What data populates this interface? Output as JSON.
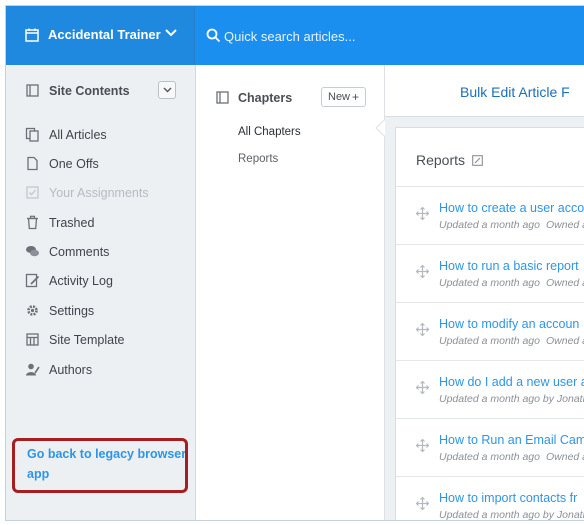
{
  "header": {
    "site_name": "Accidental Trainer",
    "search_placeholder": "Quick search articles..."
  },
  "sidebar": {
    "title": "Site Contents",
    "items": [
      {
        "label": "All Articles",
        "icon": "copy-icon",
        "disabled": false
      },
      {
        "label": "One Offs",
        "icon": "document-icon",
        "disabled": false
      },
      {
        "label": "Your Assignments",
        "icon": "checkbox-icon",
        "disabled": true
      },
      {
        "label": "Trashed",
        "icon": "trash-icon",
        "disabled": false
      },
      {
        "label": "Comments",
        "icon": "comments-icon",
        "disabled": false
      },
      {
        "label": "Activity Log",
        "icon": "activity-icon",
        "disabled": false
      },
      {
        "label": "Settings",
        "icon": "gear-icon",
        "disabled": false
      },
      {
        "label": "Site Template",
        "icon": "template-icon",
        "disabled": false
      },
      {
        "label": "Authors",
        "icon": "author-icon",
        "disabled": false
      }
    ],
    "legacy_link": "Go back to legacy browser app"
  },
  "chapters": {
    "title": "Chapters",
    "new_label": "New",
    "new_icon": "+",
    "items": [
      "All Chapters",
      "Reports"
    ]
  },
  "main": {
    "title": "Bulk Edit Article F",
    "section_title": "Reports",
    "articles": [
      {
        "title": "How to create a user acco",
        "updated": "Updated a month ago",
        "owner": "Owned a"
      },
      {
        "title": "How to run a basic report",
        "updated": "Updated a month ago",
        "owner": "Owned a"
      },
      {
        "title": "How to modify an accoun",
        "updated": "Updated a month ago",
        "owner": "Owned a"
      },
      {
        "title": "How do I add a new user a",
        "updated": "Updated a month ago by Jonath",
        "owner": ""
      },
      {
        "title": "How to Run an Email Cam",
        "updated": "Updated a month ago",
        "owner": "Owned a"
      },
      {
        "title": "How to import contacts fr",
        "updated": "Updated a month ago by Jonath",
        "owner": ""
      }
    ]
  },
  "colors": {
    "topbar": "#1b8ff0",
    "link": "#2d95e8",
    "highlight": "#a61e22",
    "sidebar_bg": "#edf0f2"
  }
}
